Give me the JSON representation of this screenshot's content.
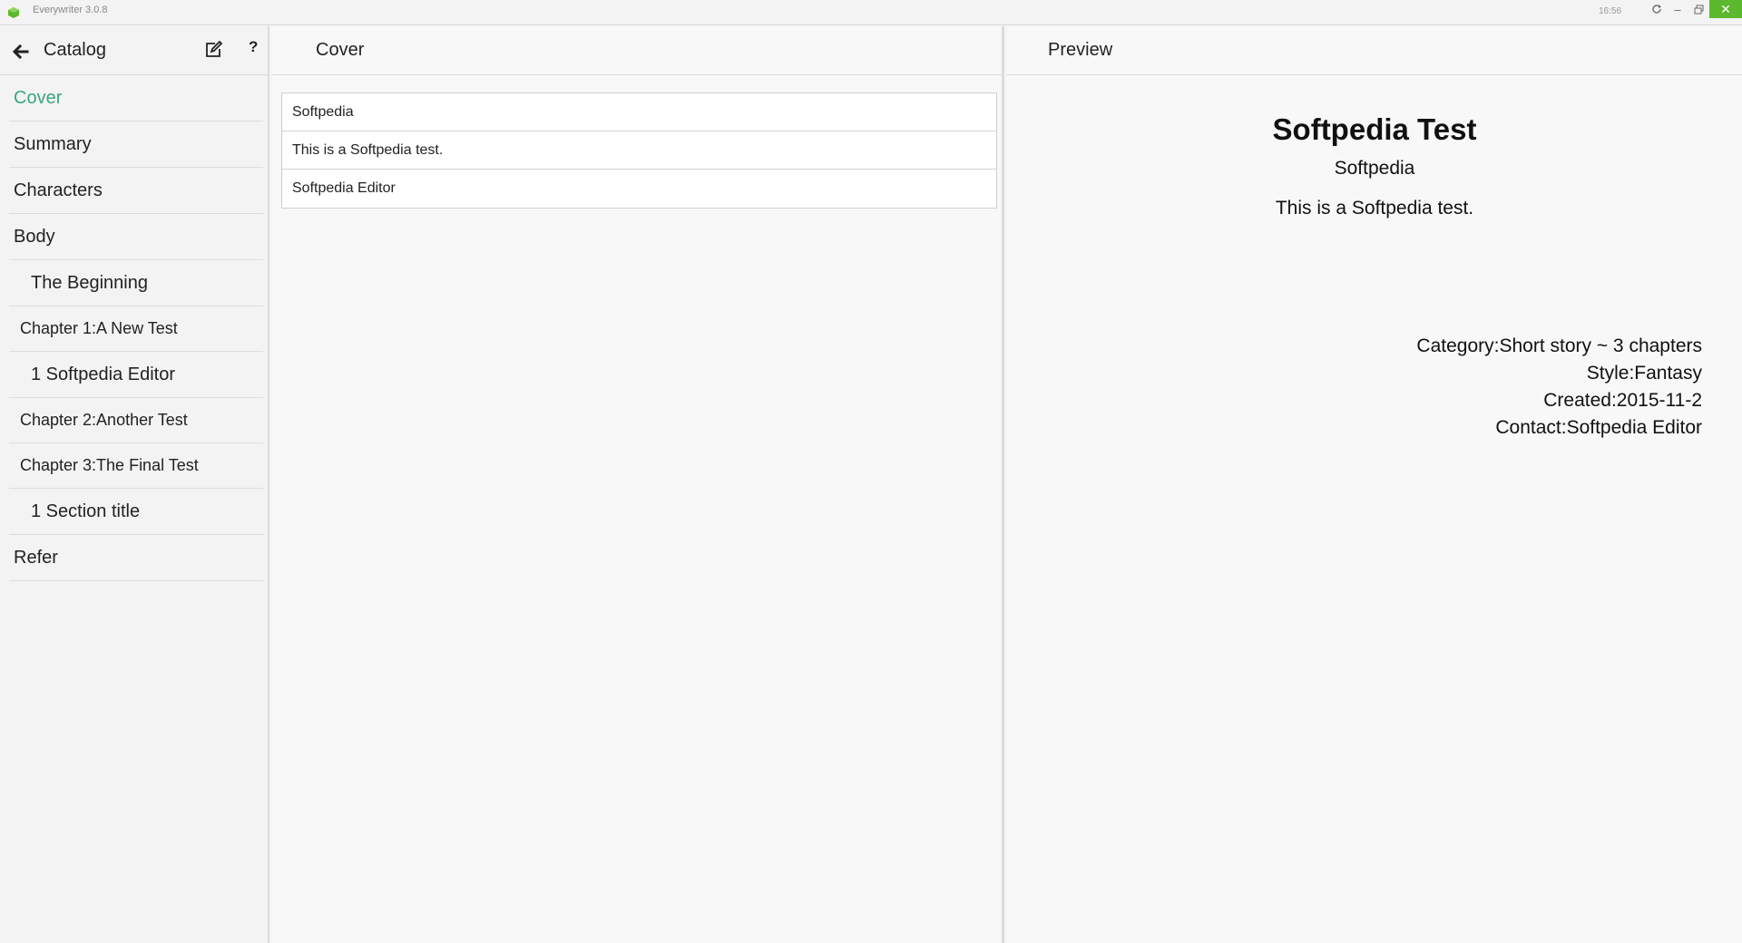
{
  "window": {
    "app_title": "Everywriter  3.0.8",
    "clock": "16:56"
  },
  "catalog": {
    "title": "Catalog",
    "items": [
      {
        "label": "Cover",
        "active": true
      },
      {
        "label": "Summary"
      },
      {
        "label": "Characters"
      },
      {
        "label": "Body"
      },
      {
        "label": "The Beginning"
      },
      {
        "label": "Chapter 1:A New Test"
      },
      {
        "label": "1 Softpedia Editor"
      },
      {
        "label": "Chapter 2:Another Test"
      },
      {
        "label": "Chapter 3:The Final Test"
      },
      {
        "label": "1 Section title"
      },
      {
        "label": "Refer"
      }
    ]
  },
  "editor": {
    "title": "Cover",
    "fields": {
      "title_value": "Softpedia",
      "desc_value": "This is a Softpedia test.",
      "author_value": "Softpedia Editor"
    }
  },
  "preview": {
    "header": "Preview",
    "book_title": "Softpedia Test",
    "subtitle": "Softpedia",
    "description": "This is a Softpedia test.",
    "category": "Category:Short story ~ 3 chapters",
    "style": "Style:Fantasy",
    "created": "Created:2015-11-2",
    "contact": "Contact:Softpedia Editor"
  },
  "colors": {
    "accent": "#3aa585",
    "close_button": "#5cb82c"
  }
}
